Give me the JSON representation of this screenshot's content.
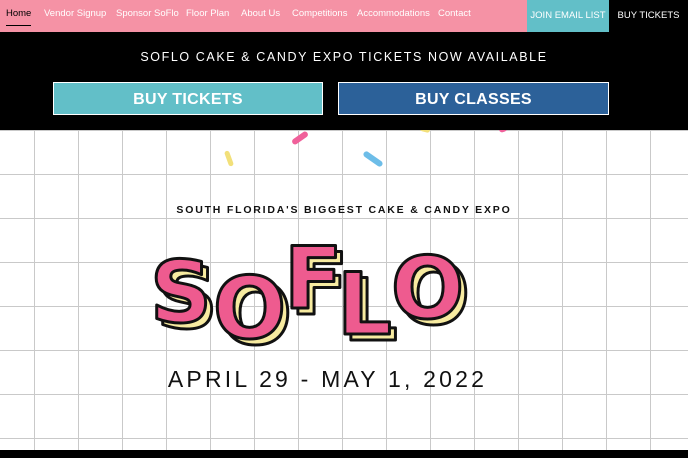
{
  "nav": {
    "items": [
      {
        "label": "Home",
        "active": true
      },
      {
        "label": "Vendor Signup"
      },
      {
        "label": "Sponsor SoFlo"
      },
      {
        "label": "Floor Plan"
      },
      {
        "label": "About Us"
      },
      {
        "label": "Competitions"
      },
      {
        "label": "Accommodations"
      },
      {
        "label": "Contact"
      }
    ],
    "email_button": "JOIN EMAIL LIST",
    "buy_button": "BUY TICKETS"
  },
  "announcement": "SOFLO CAKE & CANDY EXPO TICKETS NOW AVAILABLE",
  "cta": {
    "tickets": "BUY TICKETS",
    "classes": "BUY CLASSES"
  },
  "hero": {
    "tagline": "SOUTH FLORIDA'S BIGGEST CAKE & CANDY EXPO",
    "logo_letters": [
      "S",
      "O",
      "F",
      "L",
      "O"
    ],
    "date": "APRIL 29 - MAY 1, 2022"
  },
  "colors": {
    "nav_pink": "#f592a5",
    "teal": "#62bfc8",
    "navy": "#2c6199",
    "logo_pink": "#ee5b8f",
    "logo_yellow": "#f7eba0",
    "sprinkle_pink": "#f0609a",
    "sprinkle_blue": "#6dbde8",
    "sprinkle_yellow": "#f2e07a"
  }
}
